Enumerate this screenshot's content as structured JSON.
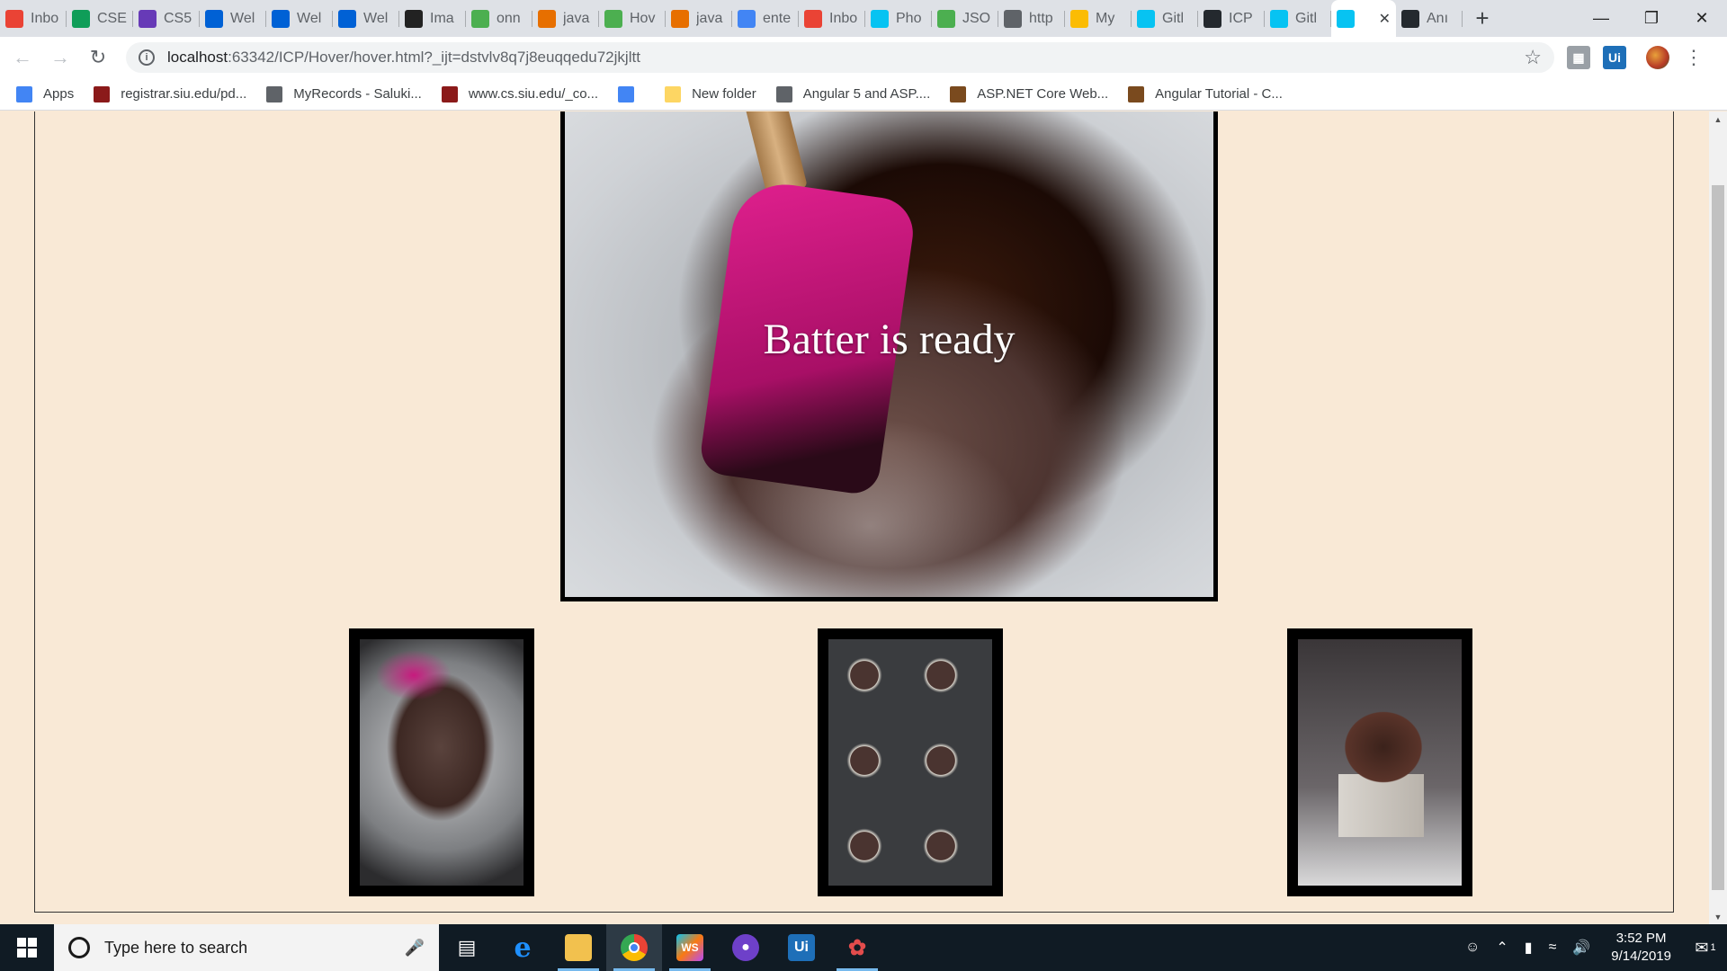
{
  "browser": {
    "tabs": [
      {
        "title": "Inbo",
        "icon": "gmail-icon",
        "color": "#ea4335"
      },
      {
        "title": "CSE",
        "icon": "sheets-icon",
        "color": "#0f9d58"
      },
      {
        "title": "CS5",
        "icon": "forms-icon",
        "color": "#673ab7"
      },
      {
        "title": "Wel",
        "icon": "box-icon",
        "color": "#0061d5"
      },
      {
        "title": "Wel",
        "icon": "box-icon",
        "color": "#0061d5"
      },
      {
        "title": "Wel",
        "icon": "box-icon",
        "color": "#0061d5"
      },
      {
        "title": "Ima",
        "icon": "codepen-icon",
        "color": "#222222"
      },
      {
        "title": "onn",
        "icon": "w3schools-icon",
        "color": "#4caf50"
      },
      {
        "title": "java",
        "icon": "java-icon",
        "color": "#e76f00"
      },
      {
        "title": "Hov",
        "icon": "w3schools-icon",
        "color": "#4caf50"
      },
      {
        "title": "java",
        "icon": "java-icon",
        "color": "#e76f00"
      },
      {
        "title": "ente",
        "icon": "google-icon",
        "color": "#4285f4"
      },
      {
        "title": "Inbo",
        "icon": "gmail-icon",
        "color": "#ea4335"
      },
      {
        "title": "Pho",
        "icon": "webstorm-icon",
        "color": "#07c3f2"
      },
      {
        "title": "JSO",
        "icon": "w3schools-icon",
        "color": "#4caf50"
      },
      {
        "title": "http",
        "icon": "globe-icon",
        "color": "#5f6368"
      },
      {
        "title": "My",
        "icon": "drive-icon",
        "color": "#fbbc04"
      },
      {
        "title": "Gitl",
        "icon": "webstorm-icon",
        "color": "#07c3f2"
      },
      {
        "title": "ICP",
        "icon": "github-icon",
        "color": "#24292e"
      },
      {
        "title": "Gitl",
        "icon": "webstorm-icon",
        "color": "#07c3f2"
      },
      {
        "title": "",
        "icon": "webstorm-icon",
        "color": "#07c3f2",
        "active": true
      },
      {
        "title": "Anı",
        "icon": "github-icon",
        "color": "#24292e"
      }
    ],
    "url_host": "localhost",
    "url_path": ":63342/ICP/Hover/hover.html?_ijt=dstvlv8q7j8euqqedu72jkjltt",
    "bookmarks": [
      {
        "label": "Apps",
        "icon": "apps-grid-icon",
        "color": "#4285f4"
      },
      {
        "label": "registrar.siu.edu/pd...",
        "icon": "siu-icon",
        "color": "#8b1a1a"
      },
      {
        "label": "MyRecords - Saluki...",
        "icon": "globe-icon",
        "color": "#5f6368"
      },
      {
        "label": "www.cs.siu.edu/_co...",
        "icon": "siu-icon",
        "color": "#8b1a1a"
      },
      {
        "label": "",
        "icon": "google-icon",
        "color": "#4285f4"
      },
      {
        "label": "New folder",
        "icon": "folder-icon",
        "color": "#fdd663"
      },
      {
        "label": "Angular 5 and ASP....",
        "icon": "globe-icon",
        "color": "#5f6368"
      },
      {
        "label": "ASP.NET Core Web...",
        "icon": "book-icon",
        "color": "#7a4a1e"
      },
      {
        "label": "Angular Tutorial - C...",
        "icon": "book-icon",
        "color": "#7a4a1e"
      }
    ]
  },
  "page": {
    "hero_caption": "Batter is ready",
    "thumbnails": [
      "batter",
      "cupcake-tin",
      "cupcake"
    ]
  },
  "taskbar": {
    "search_placeholder": "Type here to search",
    "time": "3:52 PM",
    "date": "9/14/2019",
    "notification_count": "1"
  }
}
